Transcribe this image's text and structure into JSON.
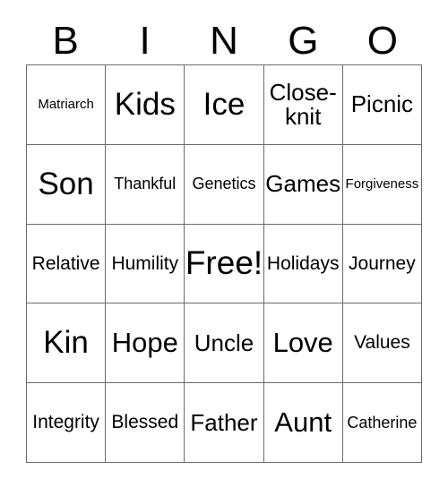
{
  "header": {
    "letters": [
      "B",
      "I",
      "N",
      "G",
      "O"
    ]
  },
  "grid": {
    "rows": [
      [
        {
          "text": "Matriarch",
          "size": "fs-xs"
        },
        {
          "text": "Kids",
          "size": "fs-xxl"
        },
        {
          "text": "Ice",
          "size": "fs-xxl"
        },
        {
          "text": "Close-knit",
          "size": "fs-l"
        },
        {
          "text": "Picnic",
          "size": "fs-l"
        }
      ],
      [
        {
          "text": "Son",
          "size": "fs-xxl"
        },
        {
          "text": "Thankful",
          "size": "fs-s"
        },
        {
          "text": "Genetics",
          "size": "fs-s"
        },
        {
          "text": "Games",
          "size": "fs-l"
        },
        {
          "text": "Forgiveness",
          "size": "fs-xs"
        }
      ],
      [
        {
          "text": "Relative",
          "size": "fs-m"
        },
        {
          "text": "Humility",
          "size": "fs-m"
        },
        {
          "text": "Free!",
          "size": "fs-free"
        },
        {
          "text": "Holidays",
          "size": "fs-m"
        },
        {
          "text": "Journey",
          "size": "fs-m"
        }
      ],
      [
        {
          "text": "Kin",
          "size": "fs-xxl"
        },
        {
          "text": "Hope",
          "size": "fs-xl"
        },
        {
          "text": "Uncle",
          "size": "fs-l"
        },
        {
          "text": "Love",
          "size": "fs-xl"
        },
        {
          "text": "Values",
          "size": "fs-m"
        }
      ],
      [
        {
          "text": "Integrity",
          "size": "fs-m"
        },
        {
          "text": "Blessed",
          "size": "fs-m"
        },
        {
          "text": "Father",
          "size": "fs-l"
        },
        {
          "text": "Aunt",
          "size": "fs-xl"
        },
        {
          "text": "Catherine",
          "size": "fs-s"
        }
      ]
    ]
  },
  "colors": {
    "text": "#000000",
    "background": "#ffffff",
    "border": "#6b6b6b"
  }
}
